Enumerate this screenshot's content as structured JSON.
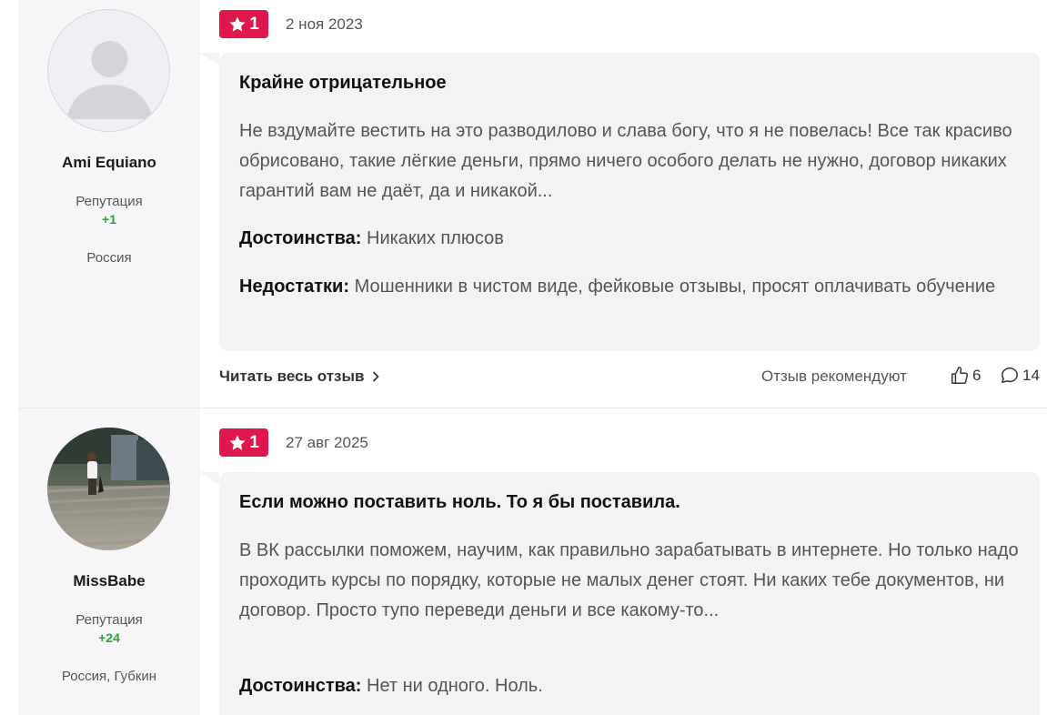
{
  "reviews": [
    {
      "author": "Ami Equiano",
      "reputation_label": "Репутация",
      "reputation_value": "+1",
      "location": "Россия",
      "rating": "1",
      "date": "2 ноя 2023",
      "title": "Крайне отрицательное",
      "text": "Не вздумайте вестить на это разводилово и слава богу, что я не повелась! Все так красиво обрисовано, такие лёгкие деньги, прямо ничего особого делать не нужно, договор никаких гарантий вам не даёт, да и никакой...",
      "pros_label": "Достоинства:",
      "pros": " Никаких плюсов",
      "cons_label": "Недостатки:",
      "cons": " Мошенники в чистом виде, фейковые отзывы, просят оплачивать обучение",
      "read_more": "Читать весь отзыв",
      "recommend_label": "Отзыв рекомендуют",
      "likes": "6",
      "comments": "14"
    },
    {
      "author": "MissBabe",
      "reputation_label": "Репутация",
      "reputation_value": "+24",
      "location": "Россия, Губкин",
      "rating": "1",
      "date": "27 авг 2025",
      "title": "Если можно поставить ноль. То я бы поставила.",
      "text": "В ВК рассылки поможем, научим, как правильно зарабатывать в интернете. Но только надо проходить курсы по порядку, которые не малых денег стоят. Ни каких тебе документов, ни договор. Просто тупо переведи деньги и все какому-то...",
      "pros_label": "Достоинства:",
      "pros": " Нет ни одного. Ноль."
    }
  ],
  "colors": {
    "rating_badge": "#e0174c",
    "reputation_positive": "#2aa63a",
    "bubble_bg": "#f3f3f6",
    "sidebar_bg": "#f6f6f8"
  },
  "icons": {
    "rating": "star-icon",
    "read_more": "chevron-right-icon",
    "likes": "thumbs-up-icon",
    "comments": "comment-bubble-icon",
    "default_avatar": "user-silhouette-icon"
  }
}
